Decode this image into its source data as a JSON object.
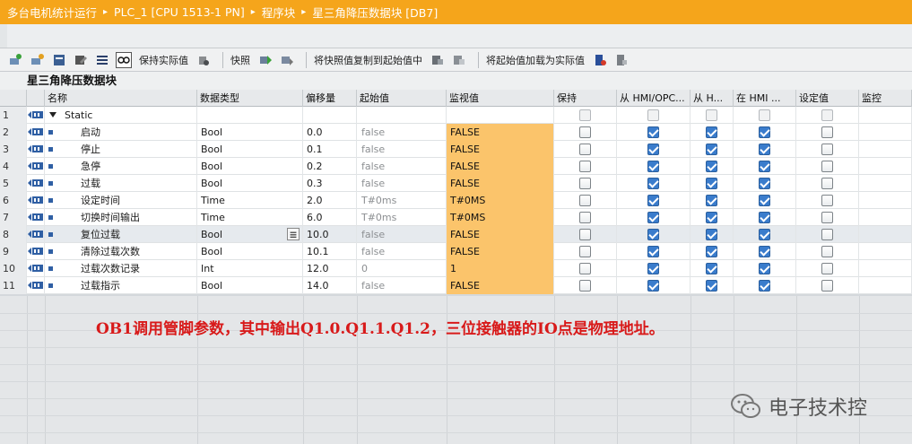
{
  "breadcrumb": {
    "items": [
      "多台电机统计运行",
      "PLC_1 [CPU 1513-1 PN]",
      "程序块",
      "星三角降压数据块 [DB7]"
    ],
    "separator": "▸"
  },
  "toolbar": {
    "keep_actual": "保持实际值",
    "snapshot": "快照",
    "copy_snapshot": "将快照值复制到起始值中",
    "load_start": "将起始值加载为实际值"
  },
  "block": {
    "title": "星三角降压数据块"
  },
  "columns": [
    "名称",
    "数据类型",
    "偏移量",
    "起始值",
    "监视值",
    "保持",
    "从 HMI/OPC...",
    "从 H...",
    "在 HMI ...",
    "设定值",
    "监控"
  ],
  "rows": [
    {
      "num": "1",
      "name": "Static",
      "type": "",
      "offset": "",
      "start": "",
      "monitor": "",
      "retain": false,
      "hmi1": false,
      "hmi2": false,
      "hmi3": false,
      "setpoint": false,
      "is_static": true
    },
    {
      "num": "2",
      "name": "启动",
      "type": "Bool",
      "offset": "0.0",
      "start": "false",
      "monitor": "FALSE",
      "retain": false,
      "hmi1": true,
      "hmi2": true,
      "hmi3": true,
      "setpoint": false
    },
    {
      "num": "3",
      "name": "停止",
      "type": "Bool",
      "offset": "0.1",
      "start": "false",
      "monitor": "FALSE",
      "retain": false,
      "hmi1": true,
      "hmi2": true,
      "hmi3": true,
      "setpoint": false
    },
    {
      "num": "4",
      "name": "急停",
      "type": "Bool",
      "offset": "0.2",
      "start": "false",
      "monitor": "FALSE",
      "retain": false,
      "hmi1": true,
      "hmi2": true,
      "hmi3": true,
      "setpoint": false
    },
    {
      "num": "5",
      "name": "过载",
      "type": "Bool",
      "offset": "0.3",
      "start": "false",
      "monitor": "FALSE",
      "retain": false,
      "hmi1": true,
      "hmi2": true,
      "hmi3": true,
      "setpoint": false
    },
    {
      "num": "6",
      "name": "设定时间",
      "type": "Time",
      "offset": "2.0",
      "start": "T#0ms",
      "monitor": "T#0MS",
      "retain": false,
      "hmi1": true,
      "hmi2": true,
      "hmi3": true,
      "setpoint": false
    },
    {
      "num": "7",
      "name": "切换时间输出",
      "type": "Time",
      "offset": "6.0",
      "start": "T#0ms",
      "monitor": "T#0MS",
      "retain": false,
      "hmi1": true,
      "hmi2": true,
      "hmi3": true,
      "setpoint": false
    },
    {
      "num": "8",
      "name": "复位过载",
      "type": "Bool",
      "offset": "10.0",
      "start": "false",
      "monitor": "FALSE",
      "retain": false,
      "hmi1": true,
      "hmi2": true,
      "hmi3": true,
      "setpoint": false,
      "selected": true
    },
    {
      "num": "9",
      "name": "清除过载次数",
      "type": "Bool",
      "offset": "10.1",
      "start": "false",
      "monitor": "FALSE",
      "retain": false,
      "hmi1": true,
      "hmi2": true,
      "hmi3": true,
      "setpoint": false
    },
    {
      "num": "10",
      "name": "过载次数记录",
      "type": "Int",
      "offset": "12.0",
      "start": "0",
      "monitor": "1",
      "retain": false,
      "hmi1": true,
      "hmi2": true,
      "hmi3": true,
      "setpoint": false
    },
    {
      "num": "11",
      "name": "过载指示",
      "type": "Bool",
      "offset": "14.0",
      "start": "false",
      "monitor": "FALSE",
      "retain": false,
      "hmi1": true,
      "hmi2": true,
      "hmi3": true,
      "setpoint": false
    }
  ],
  "annotation": "OB1调用管脚参数，其中输出Q1.0.Q1.1.Q1.2，三位接触器的IO点是物理地址。",
  "watermark": "电子技术控",
  "colors": {
    "title_bar": "#f5a51b",
    "monitor_cell": "#fbc46b",
    "annotation": "#d81a1a"
  }
}
